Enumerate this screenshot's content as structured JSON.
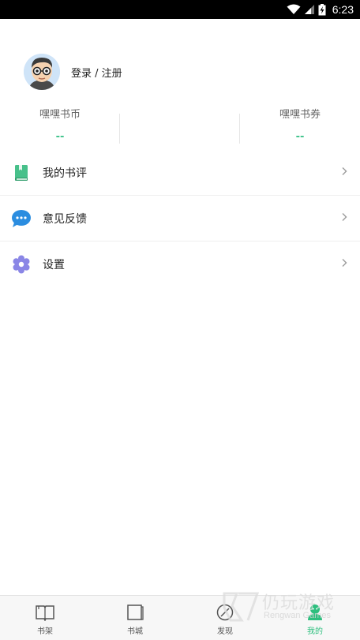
{
  "status_bar": {
    "time": "6:23"
  },
  "profile": {
    "login_text": "登录 / 注册"
  },
  "stats": [
    {
      "label": "嘿嘿书币",
      "value": "--"
    },
    {
      "label": "嘿嘿书券",
      "value": "--"
    }
  ],
  "menu": [
    {
      "label": "我的书评",
      "icon": "book-icon",
      "color": "#47c08a"
    },
    {
      "label": "意见反馈",
      "icon": "chat-bubble-icon",
      "color": "#2b8de0"
    },
    {
      "label": "设置",
      "icon": "gear-icon",
      "color": "#8a86e6"
    }
  ],
  "bottom_nav": [
    {
      "label": "书架",
      "icon": "open-book-icon",
      "active": false
    },
    {
      "label": "书城",
      "icon": "book-cover-icon",
      "active": false
    },
    {
      "label": "发现",
      "icon": "compass-icon",
      "active": false
    },
    {
      "label": "我的",
      "icon": "person-icon",
      "active": true
    }
  ],
  "watermark": {
    "text": "仍玩游戏",
    "sub": "Rengwan Games"
  },
  "colors": {
    "accent": "#2dbf7e",
    "stat_value": "#3cc28a"
  }
}
